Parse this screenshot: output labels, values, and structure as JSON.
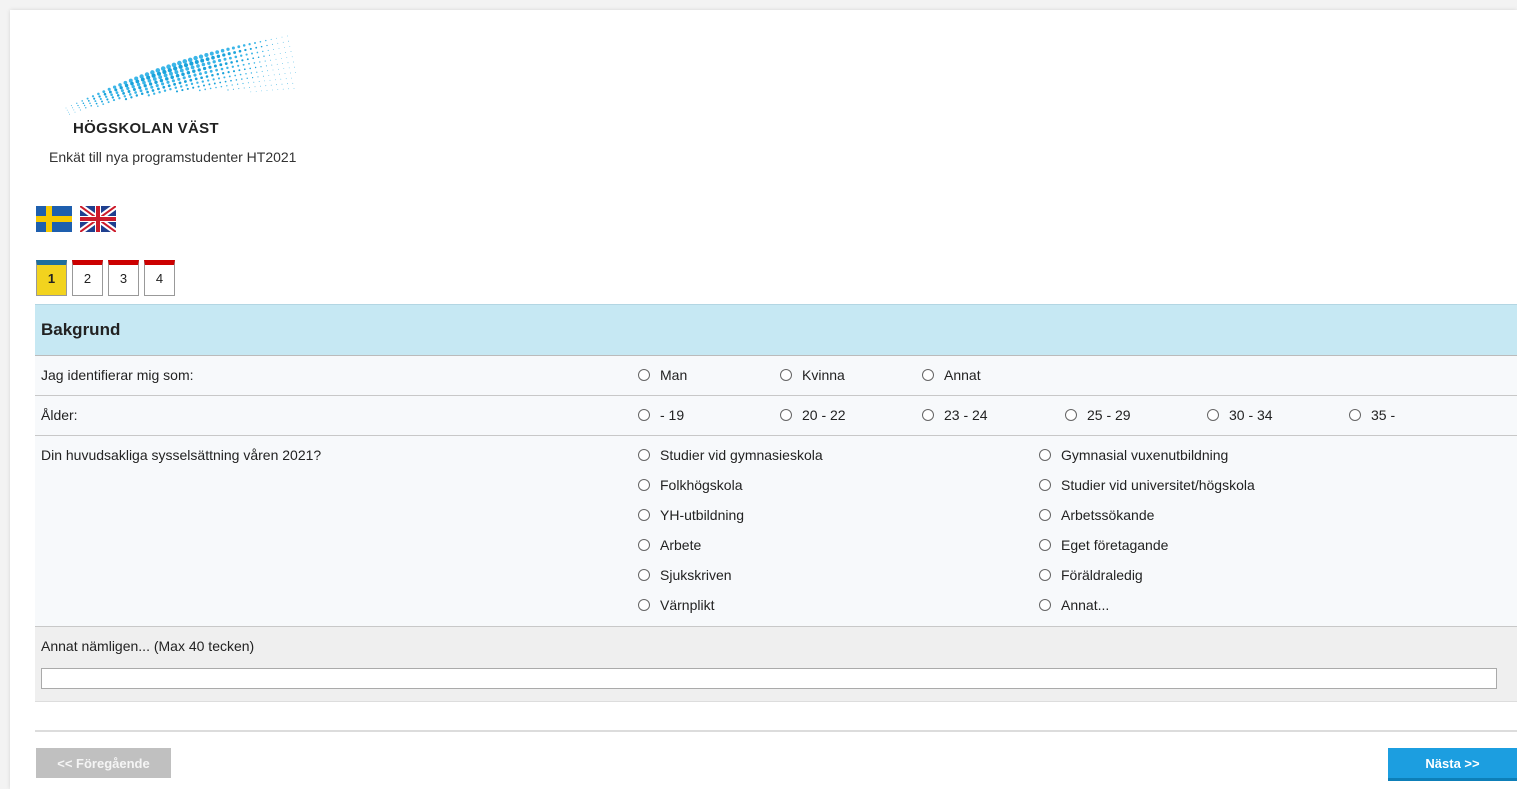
{
  "logo": {
    "name": "HÖGSKOLAN VÄST"
  },
  "survey": {
    "title": "Enkät till nya programstudenter HT2021"
  },
  "languages": [
    "swedish-flag-icon",
    "uk-flag-icon"
  ],
  "tabs": [
    {
      "label": "1",
      "active": true
    },
    {
      "label": "2",
      "active": false
    },
    {
      "label": "3",
      "active": false
    },
    {
      "label": "4",
      "active": false
    }
  ],
  "section": {
    "title": "Bakgrund"
  },
  "questions": {
    "gender": {
      "label": "Jag identifierar mig som:",
      "options": [
        "Man",
        "Kvinna",
        "Annat"
      ]
    },
    "age": {
      "label": "Ålder:",
      "options": [
        "- 19",
        "20 - 22",
        "23 - 24",
        "25 - 29",
        "30 - 34",
        "35 -"
      ]
    },
    "occupation": {
      "label": "Din huvudsakliga sysselsättning våren 2021?",
      "options": [
        "Studier vid gymnasieskola",
        "Gymnasial vuxenutbildning",
        "Folkhögskola",
        "Studier vid universitet/högskola",
        "YH-utbildning",
        "Arbetssökande",
        "Arbete",
        "Eget företagande",
        "Sjukskriven",
        "Föräldraledig",
        "Värnplikt",
        "Annat..."
      ]
    },
    "other": {
      "label": "Annat nämligen... (Max 40 tecken)",
      "value": ""
    }
  },
  "nav": {
    "prev_label": "<< Föregående",
    "next_label": "Nästa >>"
  },
  "colors": {
    "header_bg": "#c6e8f3",
    "next_button": "#1c9ee0",
    "active_tab": "#f2d31e",
    "tab_top": "#cc0000"
  }
}
